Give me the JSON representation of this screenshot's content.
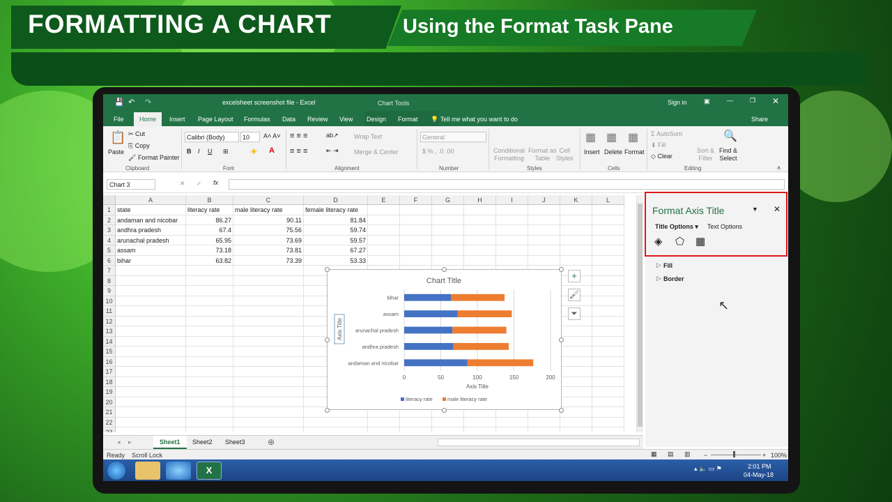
{
  "banner": {
    "title": "FORMATTING A CHART",
    "subtitle": "Using the Format Task Pane"
  },
  "excel": {
    "file_title": "excelsheet screenshot file  -  Excel",
    "context_tab": "Chart Tools",
    "sign_in": "Sign in",
    "tabs": [
      "File",
      "Home",
      "Insert",
      "Page Layout",
      "Formulas",
      "Data",
      "Review",
      "View",
      "Design",
      "Format"
    ],
    "tell_me": "Tell me what you want to do",
    "share": "Share",
    "ribbon": {
      "paste": "Paste",
      "cut": "Cut",
      "copy": "Copy",
      "format_painter": "Format Painter",
      "clipboard": "Clipboard",
      "font_name": "Calibri (Body)",
      "font_size": "10",
      "font": "Font",
      "wrap_text": "Wrap Text",
      "merge_center": "Merge & Center",
      "alignment": "Alignment",
      "number_format": "General",
      "number": "Number",
      "conditional_formatting": "Conditional\nFormatting",
      "format_as_table": "Format as\nTable",
      "cell_styles": "Cell\nStyles",
      "styles": "Styles",
      "insert": "Insert",
      "delete": "Delete",
      "format": "Format",
      "cells": "Cells",
      "autosum": "AutoSum",
      "fill": "Fill",
      "clear": "Clear",
      "sort_filter": "Sort &\nFilter",
      "find_select": "Find &\nSelect",
      "editing": "Editing"
    },
    "name_box": "Chart 3",
    "columns": [
      "A",
      "B",
      "C",
      "D",
      "E",
      "F",
      "G",
      "H",
      "I",
      "J",
      "K",
      "L"
    ],
    "rows": [
      "1",
      "2",
      "3",
      "4",
      "5",
      "6",
      "7",
      "8",
      "9",
      "10",
      "11",
      "12",
      "13",
      "14",
      "15",
      "16",
      "17",
      "18",
      "19",
      "20",
      "21",
      "22",
      "23"
    ],
    "table": {
      "headers": [
        "state",
        "literacy rate",
        "male literacy rate",
        "female literacy rate"
      ],
      "data": [
        [
          "andaman and nicobar",
          "86.27",
          "90.11",
          "81.84"
        ],
        [
          "andhra pradesh",
          "67.4",
          "75.56",
          "59.74"
        ],
        [
          "arunachal pradesh",
          "65.95",
          "73.69",
          "59.57"
        ],
        [
          "assam",
          "73.18",
          "73.81",
          "67.27"
        ],
        [
          "bihar",
          "63.82",
          "73.39",
          "53.33"
        ]
      ]
    },
    "sheets": [
      "Sheet1",
      "Sheet2",
      "Sheet3"
    ],
    "status": {
      "ready": "Ready",
      "scroll_lock": "Scroll Lock",
      "zoom": "100%"
    },
    "taskbar": {
      "time": "2:01 PM",
      "date": "04-May-18"
    }
  },
  "format_pane": {
    "title": "Format Axis Title",
    "title_options": "Title Options",
    "text_options": "Text Options",
    "sections": [
      "Fill",
      "Border"
    ]
  },
  "chart_data": {
    "type": "bar",
    "orientation": "horizontal",
    "stacked": true,
    "title": "Chart Title",
    "xlabel": "Axis Title",
    "ylabel": "Axis Title",
    "categories": [
      "andaman and nicobar",
      "andhra pradesh",
      "arunachal pradesh",
      "assam",
      "bihar"
    ],
    "series": [
      {
        "name": "literacy rate",
        "values": [
          86.27,
          67.4,
          65.95,
          73.18,
          63.82
        ],
        "color": "#4472c4"
      },
      {
        "name": "male literacy rate",
        "values": [
          90.11,
          75.56,
          73.69,
          73.81,
          73.39
        ],
        "color": "#ed7d31"
      }
    ],
    "xlim": [
      0,
      200
    ],
    "xticks": [
      "0",
      "50",
      "100",
      "150",
      "200"
    ],
    "legend": "bottom",
    "grid": true
  }
}
